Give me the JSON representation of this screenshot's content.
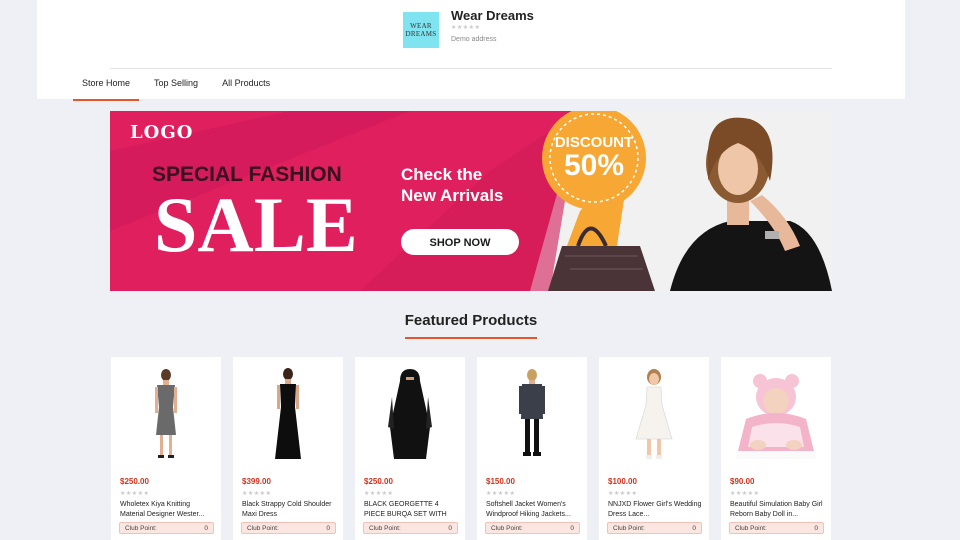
{
  "store": {
    "logo_line1": "WEAR",
    "logo_line2": "DREAMS",
    "name": "Wear Dreams",
    "rating_stars": "★★★★★",
    "address": "Demo address"
  },
  "nav": {
    "items": [
      {
        "label": "Store Home",
        "active": true
      },
      {
        "label": "Top Selling",
        "active": false
      },
      {
        "label": "All Products",
        "active": false
      }
    ]
  },
  "banner": {
    "logo_text": "LOGO",
    "headline": "SPECIAL FASHION",
    "sale_text": "SALE",
    "tagline_line1": "Check the",
    "tagline_line2": "New Arrivals",
    "button_label": "SHOP NOW",
    "discount_label": "DISCOUNT",
    "discount_value": "50%",
    "colors": {
      "magenta": "#e01f5e",
      "dark_magenta": "#b8124a",
      "orange": "#f7a733",
      "white": "#ffffff"
    }
  },
  "featured": {
    "title": "Featured Products",
    "accent_color": "#e4572e",
    "club_point_label": "Club Point:",
    "products": [
      {
        "price": "$250.00",
        "rating_stars": "★★★★★",
        "name": "Wholetex Kiya Knitting Material Designer Wester...",
        "club_points": "0",
        "image": "grey-dress-model"
      },
      {
        "price": "$399.00",
        "rating_stars": "★★★★★",
        "name": "Black Strappy Cold Shoulder Maxi Dress",
        "club_points": "0",
        "image": "black-maxi-dress-model"
      },
      {
        "price": "$250.00",
        "rating_stars": "★★★★★",
        "name": "BLACK GEORGETTE 4 PIECE BURQA SET WITH NOSE...",
        "club_points": "0",
        "image": "black-burqa-model"
      },
      {
        "price": "$150.00",
        "rating_stars": "★★★★★",
        "name": "Softshell Jacket Women's Windproof Hiking Jackets...",
        "club_points": "0",
        "image": "jacket-model"
      },
      {
        "price": "$100.00",
        "rating_stars": "★★★★★",
        "name": "NNJXD Flower Girl's Wedding Dress Lace...",
        "club_points": "0",
        "image": "white-girls-dress"
      },
      {
        "price": "$90.00",
        "rating_stars": "★★★★★",
        "name": "Beautiful Simulation Baby Girl Reborn Baby Doll in...",
        "club_points": "0",
        "image": "reborn-baby-doll"
      }
    ]
  }
}
